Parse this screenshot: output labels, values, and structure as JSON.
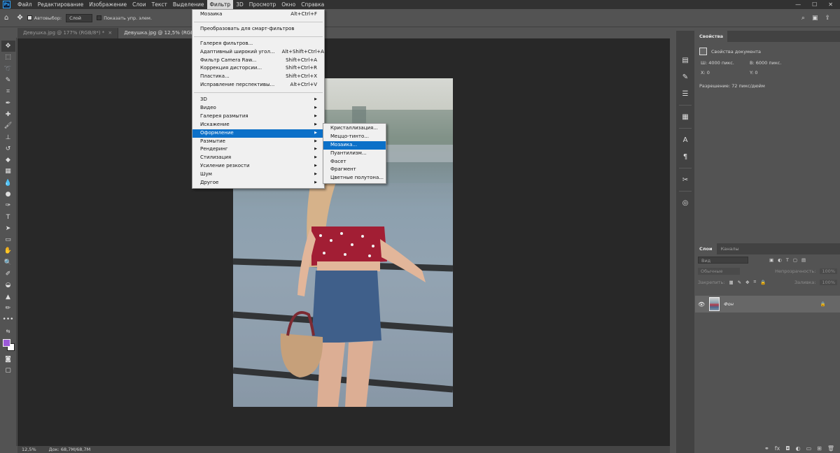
{
  "menubar": {
    "logo": "Ps",
    "items": [
      "Файл",
      "Редактирование",
      "Изображение",
      "Слои",
      "Текст",
      "Выделение",
      "Фильтр",
      "3D",
      "Просмотр",
      "Окно",
      "Справка"
    ],
    "active_index": 6,
    "window_controls": [
      "—",
      "☐",
      "✕"
    ]
  },
  "optbar": {
    "autoselect_label": "Автовыбор:",
    "autoselect_value": "Слой",
    "show_controls_label": "Показать упр. элем."
  },
  "tabs": [
    {
      "label": "Девушка.jpg @ 177% (RGB/8*) *",
      "close": "×"
    },
    {
      "label": "Девушка.jpg @ 12,5% (RGB/8*)",
      "close": "×"
    }
  ],
  "colors": {
    "foreground": "#9b59d8",
    "background": "#ffffff",
    "menu_highlight": "#0c70c8"
  },
  "filter_menu": {
    "top": [
      {
        "label": "Мозаика",
        "shortcut": "Alt+Ctrl+F"
      }
    ],
    "smart": [
      {
        "label": "Преобразовать для смарт-фильтров",
        "shortcut": ""
      }
    ],
    "galleries": [
      {
        "label": "Галерея фильтров...",
        "shortcut": ""
      },
      {
        "label": "Адаптивный широкий угол...",
        "shortcut": "Alt+Shift+Ctrl+A"
      },
      {
        "label": "Фильтр Camera Raw...",
        "shortcut": "Shift+Ctrl+A"
      },
      {
        "label": "Коррекция дисторсии...",
        "shortcut": "Shift+Ctrl+R"
      },
      {
        "label": "Пластика...",
        "shortcut": "Shift+Ctrl+X"
      },
      {
        "label": "Исправление перспективы...",
        "shortcut": "Alt+Ctrl+V"
      }
    ],
    "submenus": [
      "3D",
      "Видео",
      "Галерея размытия",
      "Искажение",
      "Оформление",
      "Размытие",
      "Рендеринг",
      "Стилизация",
      "Усиление резкости",
      "Шум",
      "Другое"
    ],
    "highlighted_submenu": "Оформление",
    "arrow": "▶"
  },
  "submenu": {
    "items": [
      "Кристаллизация...",
      "Меццо-тинто...",
      "Мозаика...",
      "Пуантилизм...",
      "Фасет",
      "Фрагмент",
      "Цветные полутона..."
    ],
    "highlighted": "Мозаика..."
  },
  "properties": {
    "tab": "Свойства",
    "doc_label": "Свойства документа",
    "w_label": "Ш:",
    "w_value": "4000 пикс.",
    "h_label": "В:",
    "h_value": "6000 пикс.",
    "x_label": "X:",
    "x_value": "0",
    "y_label": "Y:",
    "y_value": "0",
    "resolution": "Разрешение: 72 пикс/дюйм"
  },
  "layers": {
    "tabs": [
      "Слои",
      "Каналы"
    ],
    "search_placeholder": "Вид",
    "blend_mode": "Обычные",
    "opacity_label": "Непрозрачность:",
    "opacity_value": "100%",
    "lock_label": "Закрепить:",
    "fill_label": "Заливка:",
    "fill_value": "100%",
    "layer_name": "Фон"
  },
  "status": {
    "zoom": "12,5%",
    "doc": "Док: 68,7M/68,7M"
  }
}
